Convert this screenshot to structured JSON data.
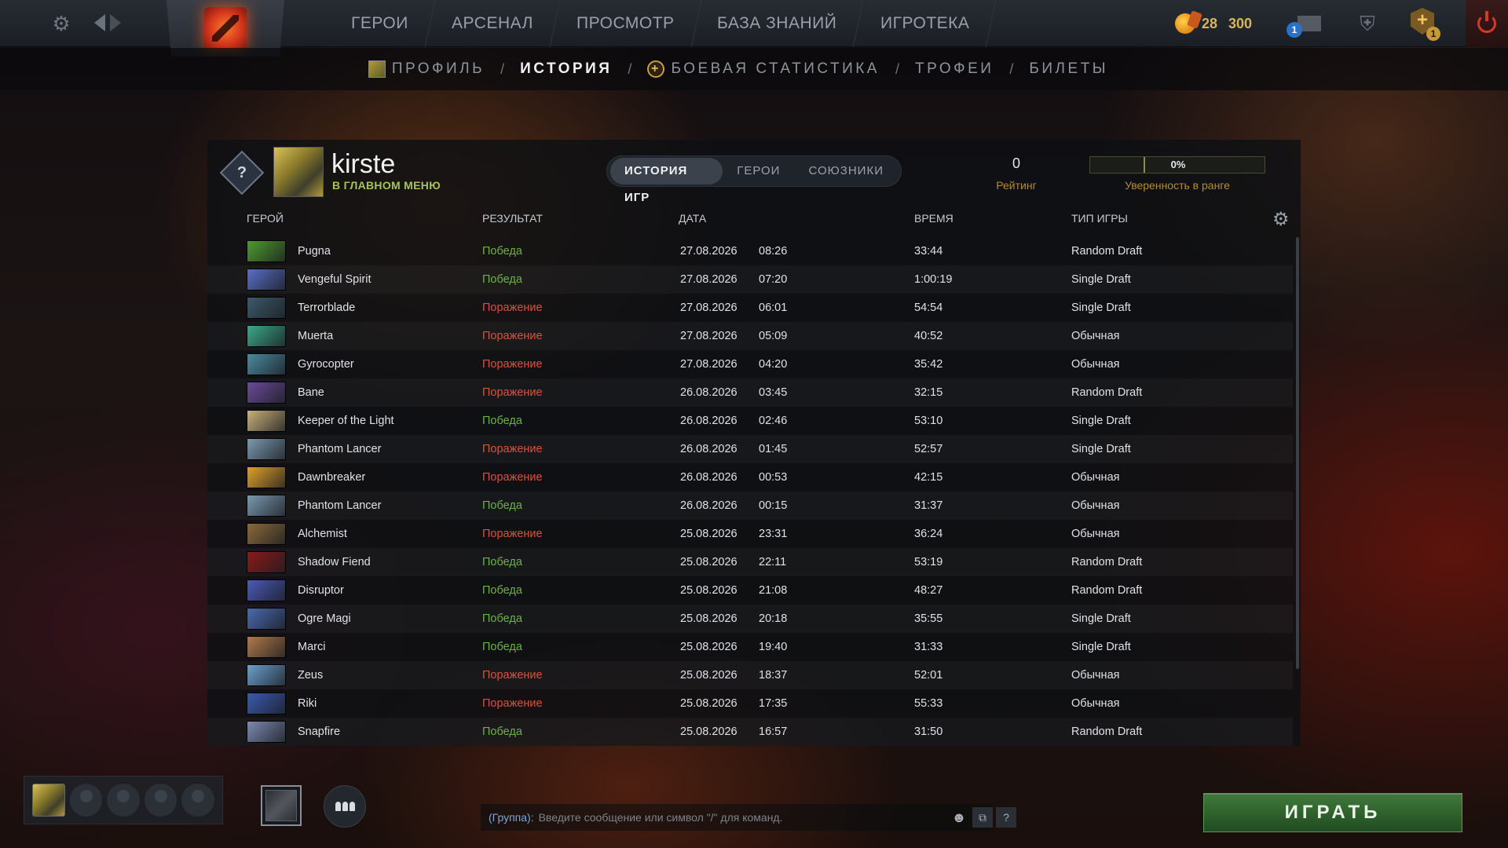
{
  "topbar": {
    "nav": [
      "ГЕРОИ",
      "АРСЕНАЛ",
      "ПРОСМОТР",
      "БАЗА ЗНАНИЙ",
      "ИГРОТЕКА"
    ],
    "currency": {
      "shards": "28",
      "coins": "300"
    },
    "mail_badge": "1",
    "plus_badge": "1"
  },
  "subnav": {
    "profile": "ПРОФИЛЬ",
    "history": "ИСТОРИЯ",
    "stats": "БОЕВАЯ СТАТИСТИКА",
    "trophies": "ТРОФЕИ",
    "tickets": "БИЛЕТЫ",
    "separator": "/"
  },
  "profile": {
    "username": "kirste",
    "status": "В ГЛАВНОМ МЕНЮ",
    "rank_medal": "?",
    "rating_value": "0",
    "rating_label": "Рейтинг",
    "confidence_value": "0%",
    "confidence_label": "Уверенность в ранге"
  },
  "tabs": [
    "ИСТОРИЯ ИГР",
    "ГЕРОИ",
    "СОЮЗНИКИ"
  ],
  "columns": {
    "hero": "ГЕРОЙ",
    "result": "РЕЗУЛЬТАТ",
    "date": "ДАТА",
    "duration": "ВРЕМЯ",
    "mode": "ТИП ИГРЫ"
  },
  "matches": [
    {
      "hero": "Pugna",
      "result": "Победа",
      "win": true,
      "date": "27.08.2026",
      "time": "08:26",
      "duration": "33:44",
      "mode": "Random Draft",
      "color": "#4f9a2e"
    },
    {
      "hero": "Vengeful Spirit",
      "result": "Победа",
      "win": true,
      "date": "27.08.2026",
      "time": "07:20",
      "duration": "1:00:19",
      "mode": "Single Draft",
      "color": "#5a6ec8"
    },
    {
      "hero": "Terrorblade",
      "result": "Поражение",
      "win": false,
      "date": "27.08.2026",
      "time": "06:01",
      "duration": "54:54",
      "mode": "Single Draft",
      "color": "#3b5a6a"
    },
    {
      "hero": "Muerta",
      "result": "Поражение",
      "win": false,
      "date": "27.08.2026",
      "time": "05:09",
      "duration": "40:52",
      "mode": "Обычная",
      "color": "#3aa88a"
    },
    {
      "hero": "Gyrocopter",
      "result": "Поражение",
      "win": false,
      "date": "27.08.2026",
      "time": "04:20",
      "duration": "35:42",
      "mode": "Обычная",
      "color": "#4a8aa0"
    },
    {
      "hero": "Bane",
      "result": "Поражение",
      "win": false,
      "date": "26.08.2026",
      "time": "03:45",
      "duration": "32:15",
      "mode": "Random Draft",
      "color": "#6a4a9a"
    },
    {
      "hero": "Keeper of the Light",
      "result": "Победа",
      "win": true,
      "date": "26.08.2026",
      "time": "02:46",
      "duration": "53:10",
      "mode": "Single Draft",
      "color": "#c8b07a"
    },
    {
      "hero": "Phantom Lancer",
      "result": "Поражение",
      "win": false,
      "date": "26.08.2026",
      "time": "01:45",
      "duration": "52:57",
      "mode": "Single Draft",
      "color": "#7a9ab0"
    },
    {
      "hero": "Dawnbreaker",
      "result": "Поражение",
      "win": false,
      "date": "26.08.2026",
      "time": "00:53",
      "duration": "42:15",
      "mode": "Обычная",
      "color": "#e0a02a"
    },
    {
      "hero": "Phantom Lancer",
      "result": "Победа",
      "win": true,
      "date": "26.08.2026",
      "time": "00:15",
      "duration": "31:37",
      "mode": "Обычная",
      "color": "#7a9ab0"
    },
    {
      "hero": "Alchemist",
      "result": "Поражение",
      "win": false,
      "date": "25.08.2026",
      "time": "23:31",
      "duration": "36:24",
      "mode": "Обычная",
      "color": "#8a6a3a"
    },
    {
      "hero": "Shadow Fiend",
      "result": "Победа",
      "win": true,
      "date": "25.08.2026",
      "time": "22:11",
      "duration": "53:19",
      "mode": "Random Draft",
      "color": "#8a1a1a"
    },
    {
      "hero": "Disruptor",
      "result": "Победа",
      "win": true,
      "date": "25.08.2026",
      "time": "21:08",
      "duration": "48:27",
      "mode": "Random Draft",
      "color": "#4a5ab8"
    },
    {
      "hero": "Ogre Magi",
      "result": "Победа",
      "win": true,
      "date": "25.08.2026",
      "time": "20:18",
      "duration": "35:55",
      "mode": "Single Draft",
      "color": "#4a6ab0"
    },
    {
      "hero": "Marci",
      "result": "Победа",
      "win": true,
      "date": "25.08.2026",
      "time": "19:40",
      "duration": "31:33",
      "mode": "Single Draft",
      "color": "#b07a4a"
    },
    {
      "hero": "Zeus",
      "result": "Поражение",
      "win": false,
      "date": "25.08.2026",
      "time": "18:37",
      "duration": "52:01",
      "mode": "Обычная",
      "color": "#6aa0d0"
    },
    {
      "hero": "Riki",
      "result": "Поражение",
      "win": false,
      "date": "25.08.2026",
      "time": "17:35",
      "duration": "55:33",
      "mode": "Обычная",
      "color": "#3a5ab0"
    },
    {
      "hero": "Snapfire",
      "result": "Победа",
      "win": true,
      "date": "25.08.2026",
      "time": "16:57",
      "duration": "31:50",
      "mode": "Random Draft",
      "color": "#7a8ab0"
    }
  ],
  "colors": {
    "win": "#6ab344",
    "loss": "#d9523e",
    "accent": "#b58a3a"
  },
  "chat": {
    "channel": "(Группа):",
    "placeholder": "Введите сообщение или символ \"/\" для команд."
  },
  "play_button": "ИГРАТЬ"
}
